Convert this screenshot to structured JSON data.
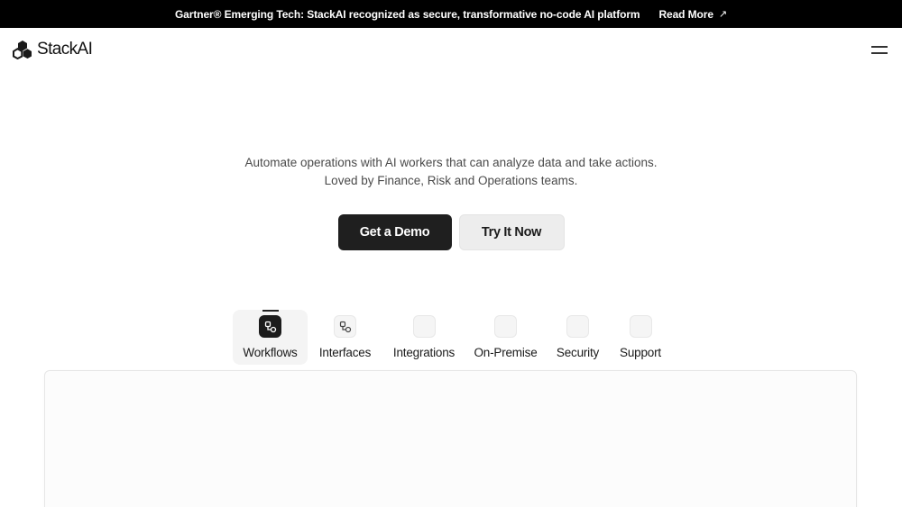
{
  "announcement": {
    "message": "Gartner® Emerging Tech: StackAI recognized as secure, transformative no-code AI platform",
    "link_label": "Read More",
    "link_icon": "arrow-up-right-icon"
  },
  "header": {
    "brand_name": "StackAI",
    "logo_icon": "stackai-logo-icon",
    "menu_icon": "hamburger-menu-icon"
  },
  "hero": {
    "line1": "Automate operations with AI workers that can analyze data and take actions.",
    "line2": "Loved by Finance, Risk and Operations teams.",
    "primary_cta": "Get a Demo",
    "secondary_cta": "Try It Now"
  },
  "tabs": [
    {
      "label": "Workflows",
      "icon": "workflow-icon",
      "active": true
    },
    {
      "label": "Interfaces",
      "icon": "interfaces-icon",
      "active": false
    },
    {
      "label": "Integrations",
      "icon": "integrations-icon",
      "active": false
    },
    {
      "label": "On-Premise",
      "icon": "on-premise-icon",
      "active": false
    },
    {
      "label": "Security",
      "icon": "security-icon",
      "active": false
    },
    {
      "label": "Support",
      "icon": "support-icon",
      "active": false
    }
  ],
  "colors": {
    "announcement_bg": "#000000",
    "primary_button": "#1f1f1f",
    "secondary_button": "#ededed",
    "active_tab_bg": "#f4f4f4"
  }
}
